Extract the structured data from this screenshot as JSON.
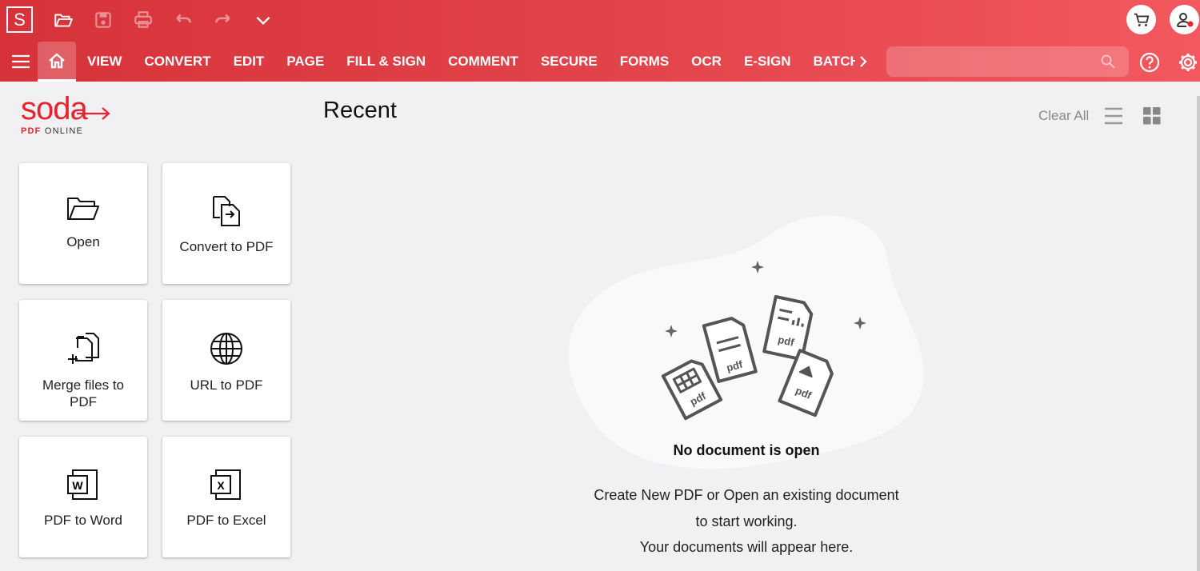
{
  "toolbar": {
    "app_logo": "S",
    "icons": [
      "folder-open-icon",
      "save-icon",
      "print-icon",
      "undo-icon",
      "redo-icon",
      "chevron-down-icon"
    ]
  },
  "nav": {
    "tabs": [
      "VIEW",
      "CONVERT",
      "EDIT",
      "PAGE",
      "FILL & SIGN",
      "COMMENT",
      "SECURE",
      "FORMS",
      "OCR",
      "E-SIGN",
      "BATCH"
    ],
    "search_placeholder": ""
  },
  "brand": {
    "name": "soda",
    "sub_red": "PDF",
    "sub": "ONLINE",
    "color": "#e8232f"
  },
  "cards": [
    {
      "label": "Open"
    },
    {
      "label": "Convert to PDF"
    },
    {
      "label": "Merge files to PDF"
    },
    {
      "label": "URL to PDF"
    },
    {
      "label": "PDF to Word"
    },
    {
      "label": "PDF to Excel"
    }
  ],
  "main": {
    "title": "Recent",
    "clear_all": "Clear All",
    "empty_title": "No document is open",
    "empty_lines": [
      "Create New PDF or Open an existing document",
      "to start working.",
      "Your documents will appear here."
    ],
    "pdf_label": "pdf"
  },
  "colors": {
    "header_start": "#d7323a",
    "header_end": "#f2585e",
    "background": "#f1f0f3"
  }
}
